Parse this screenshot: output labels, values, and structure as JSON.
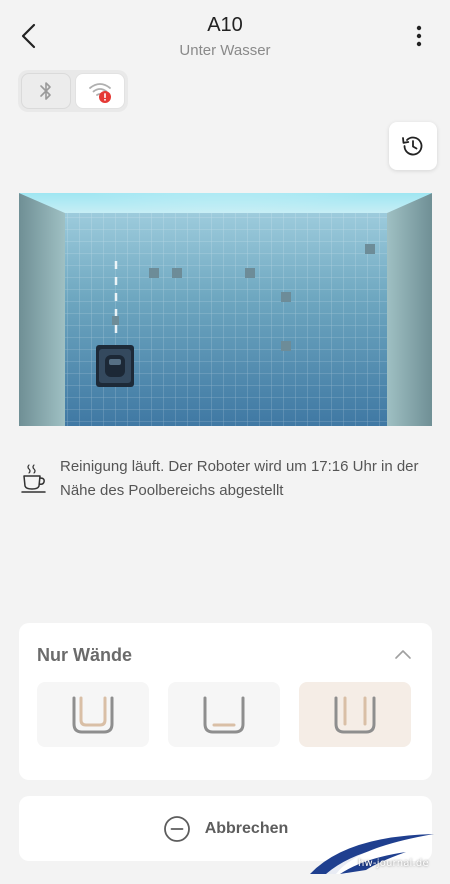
{
  "header": {
    "title": "A10",
    "subtitle": "Unter Wasser",
    "back_icon": "chevron-left-icon",
    "more_icon": "more-vertical-icon"
  },
  "connection": {
    "bluetooth": {
      "icon": "bluetooth-icon",
      "state": "inactive"
    },
    "wifi": {
      "icon": "wifi-icon",
      "state": "error",
      "badge": "!"
    }
  },
  "history": {
    "icon": "history-icon"
  },
  "status": {
    "icon": "coffee-cup-icon",
    "text": "Reinigung läuft. Der Roboter wird um 17:16 Uhr in der Nähe des Poolbereichs abgestellt"
  },
  "mode_panel": {
    "title": "Nur Wände",
    "collapse_icon": "chevron-up-icon",
    "options": [
      {
        "name": "wall-and-floor",
        "icon": "pool-walls-floor-icon",
        "selected": false
      },
      {
        "name": "floor-only",
        "icon": "pool-floor-icon",
        "selected": false
      },
      {
        "name": "walls-only",
        "icon": "pool-walls-icon",
        "selected": true
      }
    ]
  },
  "cancel": {
    "label": "Abbrechen",
    "icon": "minus-circle-icon"
  },
  "watermark": {
    "text": "hw-journal.de"
  },
  "colors": {
    "background": "#f3f3f3",
    "accent_beige": "#d9bfa6",
    "error_red": "#e53935",
    "pool_water": "#6aa3bd"
  }
}
